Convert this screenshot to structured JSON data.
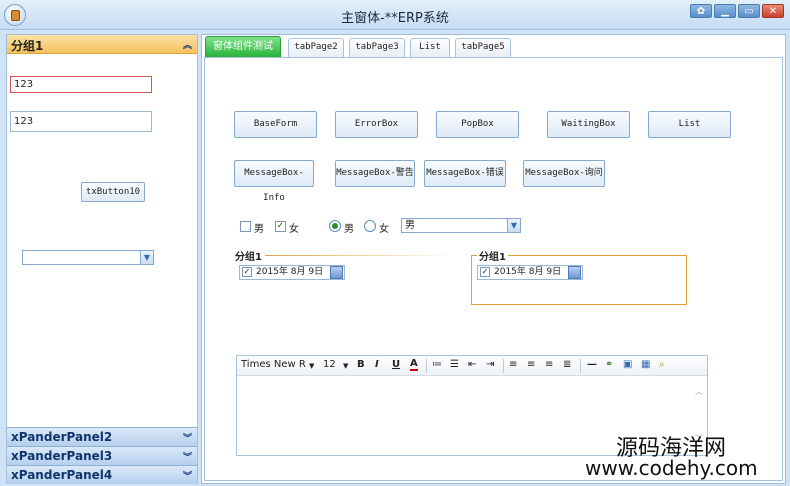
{
  "window": {
    "title": "主窗体-**ERP系统",
    "buttons": [
      "shirt-icon",
      "minimize",
      "maximize",
      "close"
    ]
  },
  "leftPanel": {
    "panels": [
      {
        "label": "分组1",
        "expanded": true,
        "chevron": "»"
      },
      {
        "label": "xPanderPanel2",
        "expanded": false,
        "chevron": "»"
      },
      {
        "label": "xPanderPanel3",
        "expanded": false,
        "chevron": "»"
      },
      {
        "label": "xPanderPanel4",
        "expanded": false,
        "chevron": "»"
      }
    ],
    "input1": "123",
    "input2": "123",
    "button": "txButton10",
    "combo": ""
  },
  "tabs": [
    {
      "label": "窗体组件测试",
      "active": true
    },
    {
      "label": "tabPage2",
      "active": false
    },
    {
      "label": "tabPage3",
      "active": false
    },
    {
      "label": "List",
      "active": false
    },
    {
      "label": "tabPage5",
      "active": false
    }
  ],
  "buttonsRow1": [
    "BaseForm",
    "ErrorBox",
    "PopBox",
    "WaitingBox",
    "List"
  ],
  "buttonsRow2": [
    "MessageBox-Info",
    "MessageBox-警告",
    "MessageBox-错误",
    "MessageBox-询问"
  ],
  "checkboxes": [
    {
      "label": "男",
      "checked": false
    },
    {
      "label": "女",
      "checked": true
    }
  ],
  "radios": [
    {
      "label": "男",
      "selected": true
    },
    {
      "label": "女",
      "selected": false
    }
  ],
  "genderCombo": "男",
  "group1": {
    "title": "分组1",
    "date": "2015年  8月  9日",
    "checked": true
  },
  "group2": {
    "title": "分组1",
    "date": "2015年  8月  9日",
    "checked": true
  },
  "editor": {
    "font": "Times New R",
    "size": "12",
    "content": ""
  },
  "watermark": {
    "line1": "源码海洋网",
    "line2": "www.codehy.com"
  },
  "colors": {
    "activeTab": "#27b23a",
    "panelHeader": "#f5c15b",
    "groupBorder": "#e0a040"
  }
}
